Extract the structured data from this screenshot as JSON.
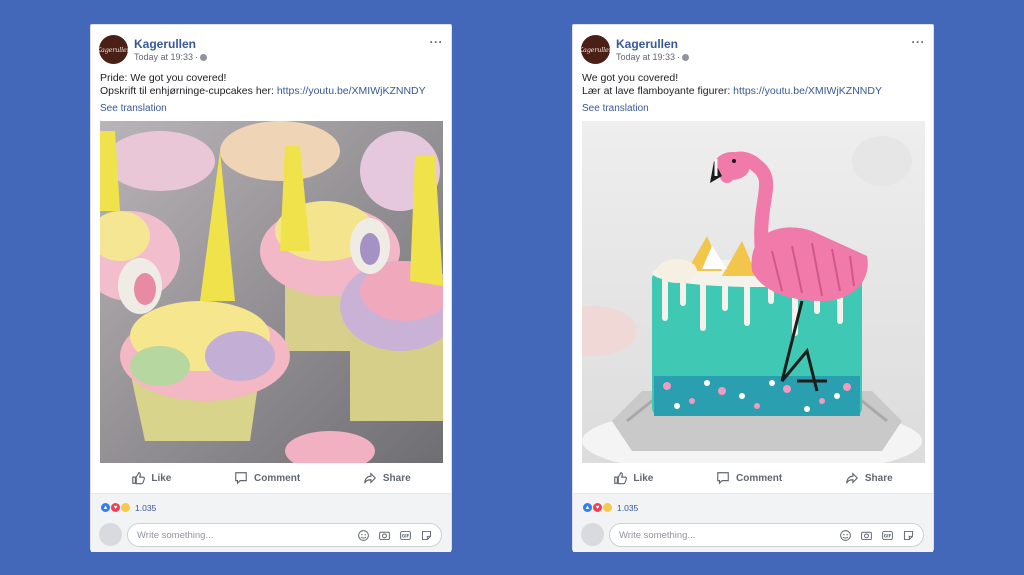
{
  "posts": [
    {
      "page_name": "Kagerullen",
      "avatar_text": "Kagerullen",
      "timestamp": "Today at 19:33",
      "separator": "·",
      "more_label": "···",
      "line1": "Pride: We got you covered!",
      "line2_prefix": "Opskrift til enhjørninge-cupcakes her:",
      "link": "https://youtu.be/XMIWjKZNNDY",
      "see_translation": "See translation",
      "image_icon": "unicorn-cupcakes-photo",
      "actions": {
        "like": "Like",
        "comment": "Comment",
        "share": "Share"
      },
      "reaction_count": "1.035",
      "composer_placeholder": "Write something..."
    },
    {
      "page_name": "Kagerullen",
      "avatar_text": "Kagerullen",
      "timestamp": "Today at 19:33",
      "separator": "·",
      "more_label": "···",
      "line1": "We got you covered!",
      "line2_prefix": "Lær at lave flamboyante figurer:",
      "link": "https://youtu.be/XMIWjKZNNDY",
      "see_translation": "See translation",
      "image_icon": "flamingo-cake-photo",
      "actions": {
        "like": "Like",
        "comment": "Comment",
        "share": "Share"
      },
      "reaction_count": "1.035",
      "composer_placeholder": "Write something..."
    }
  ],
  "colors": {
    "background": "#4468b9",
    "link": "#385898",
    "like": "#2f7ef6",
    "love": "#f33e58",
    "wow": "#f7c84a"
  },
  "icons": [
    "like-icon",
    "comment-icon",
    "share-icon",
    "smiley-icon",
    "camera-icon",
    "gif-icon",
    "sticker-icon",
    "globe-icon",
    "more-icon"
  ]
}
